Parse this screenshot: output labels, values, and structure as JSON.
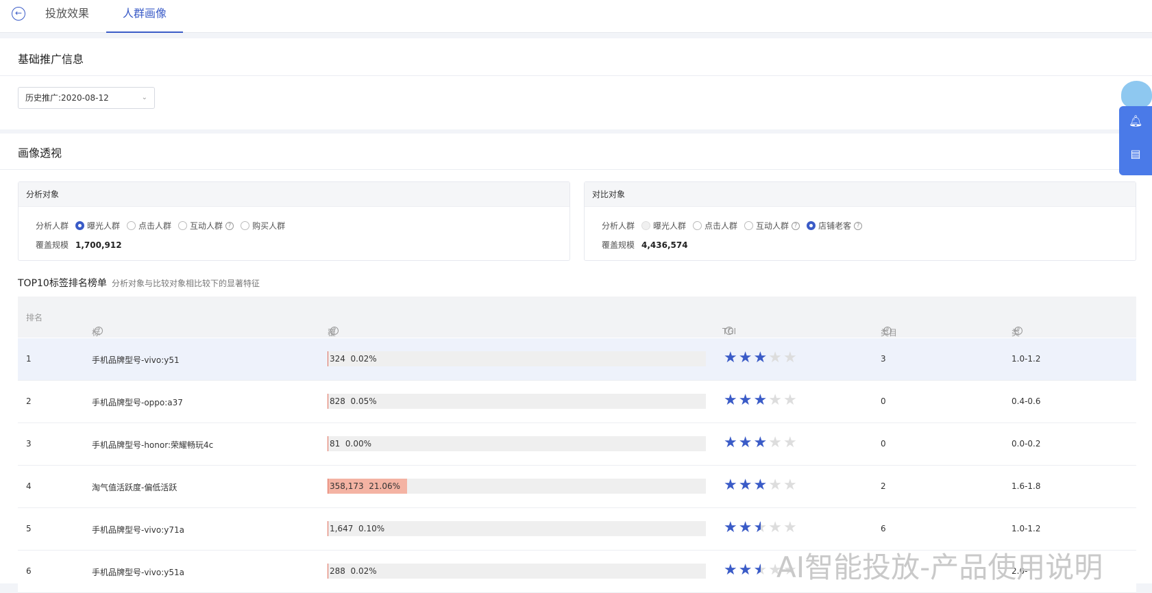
{
  "tabs": [
    {
      "label": "投放效果"
    },
    {
      "label": "人群画像"
    }
  ],
  "basic_info": {
    "title": "基础推广信息",
    "history_select": "历史推广:2020-08-12"
  },
  "portrait": {
    "title": "画像透视"
  },
  "analysis": {
    "title": "分析对象",
    "group_label": "分析人群",
    "options": [
      {
        "label": "曝光人群",
        "state": "selected"
      },
      {
        "label": "点击人群",
        "state": "normal"
      },
      {
        "label": "互动人群",
        "state": "normal"
      },
      {
        "label": "购买人群",
        "state": "normal"
      }
    ],
    "scale_label": "覆盖规模",
    "scale_value": "1,700,912"
  },
  "compare": {
    "title": "对比对象",
    "group_label": "分析人群",
    "options": [
      {
        "label": "曝光人群",
        "state": "disabled"
      },
      {
        "label": "点击人群",
        "state": "normal"
      },
      {
        "label": "互动人群",
        "state": "normal"
      },
      {
        "label": "店铺老客",
        "state": "selected"
      }
    ],
    "scale_label": "覆盖规模",
    "scale_value": "4,436,574"
  },
  "ranking": {
    "title": "TOP10标签排名榜单",
    "subtitle": "分析对象与比较对象相比较下的显著特征",
    "headers": [
      "排名",
      "标签名称",
      "覆盖数/占比",
      "TGI",
      "类目CTR",
      "类目PPC"
    ],
    "rows": [
      {
        "rank": "1",
        "name": "手机品牌型号-vivo:y51",
        "count": "324",
        "ratio": "0.02%",
        "fill": 0.0002,
        "stars": 3,
        "ctr": "3",
        "ppc": "1.0-1.2"
      },
      {
        "rank": "2",
        "name": "手机品牌型号-oppo:a37",
        "count": "828",
        "ratio": "0.05%",
        "fill": 0.0005,
        "stars": 3,
        "ctr": "0",
        "ppc": "0.4-0.6"
      },
      {
        "rank": "3",
        "name": "手机品牌型号-honor:荣耀畅玩4c",
        "count": "81",
        "ratio": "0.00%",
        "fill": 0,
        "stars": 3,
        "ctr": "0",
        "ppc": "0.0-0.2"
      },
      {
        "rank": "4",
        "name": "淘气值活跃度-偏低活跃",
        "count": "358,173",
        "ratio": "21.06%",
        "fill": 0.2106,
        "stars": 3,
        "ctr": "2",
        "ppc": "1.6-1.8"
      },
      {
        "rank": "5",
        "name": "手机品牌型号-vivo:y71a",
        "count": "1,647",
        "ratio": "0.10%",
        "fill": 0.001,
        "stars": 2.5,
        "ctr": "6",
        "ppc": "1.0-1.2"
      },
      {
        "rank": "6",
        "name": "手机品牌型号-vivo:y51a",
        "count": "288",
        "ratio": "0.02%",
        "fill": 0.0002,
        "stars": 2.5,
        "ctr": "",
        "ppc": "2.0-"
      }
    ]
  },
  "colors": {
    "accent": "#3a5bc7",
    "bar_fill": "#f4b3a3"
  },
  "icons": {
    "back": "arrow-left-icon",
    "bell": "bell-icon",
    "message": "message-icon"
  },
  "footer": "AI智能投放-产品使用说明"
}
